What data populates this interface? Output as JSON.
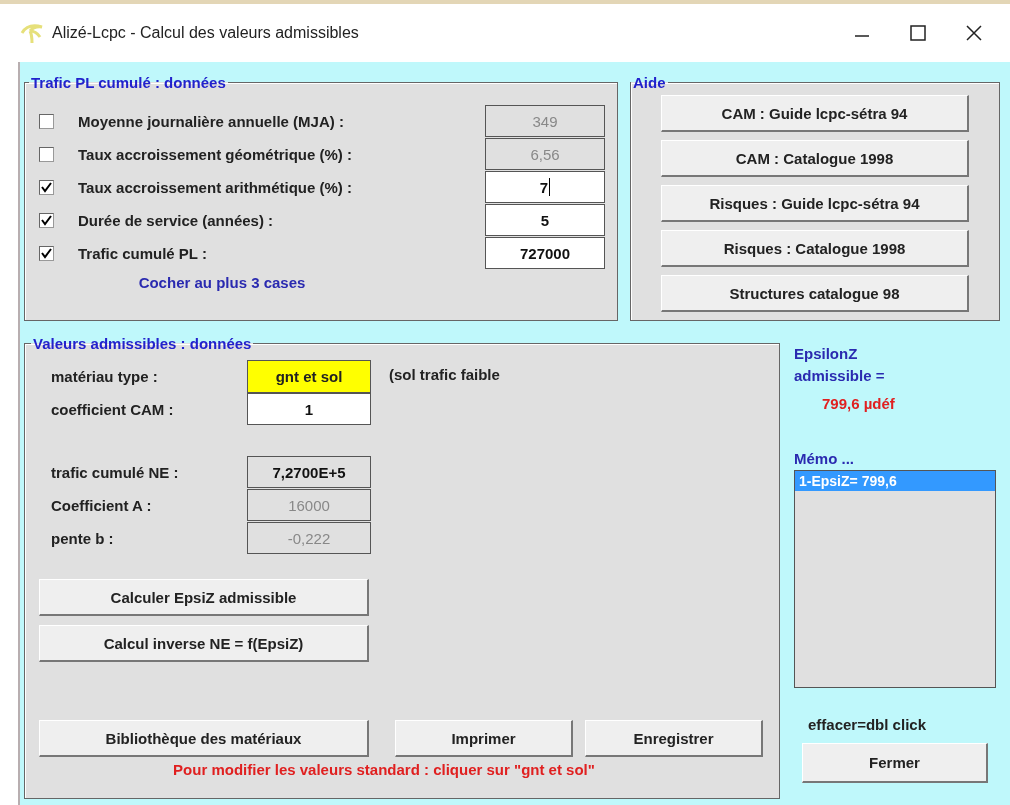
{
  "window": {
    "title": "Alizé-Lcpc - Calcul des valeurs admissibles"
  },
  "trafic": {
    "title": "Trafic PL cumulé : données",
    "rows": [
      {
        "label": "Moyenne journalière annuelle (MJA) :",
        "checked": false,
        "value": "349",
        "disabled": true,
        "focused": false
      },
      {
        "label": "Taux accroissement géométrique (%) :",
        "checked": false,
        "value": "6,56",
        "disabled": true,
        "focused": false
      },
      {
        "label": "Taux accroissement arithmétique (%) :",
        "checked": true,
        "value": "7",
        "disabled": false,
        "focused": true
      },
      {
        "label": "Durée de service  (années) :",
        "checked": true,
        "value": "5",
        "disabled": false,
        "focused": false
      },
      {
        "label": "Trafic cumulé PL :",
        "checked": true,
        "value": "727000",
        "disabled": false,
        "focused": false
      }
    ],
    "hint": "Cocher au plus 3 cases"
  },
  "aide": {
    "title": "Aide",
    "buttons": [
      "CAM : Guide lcpc-sétra 94",
      "CAM : Catalogue 1998",
      "Risques : Guide lcpc-sétra 94",
      "Risques : Catalogue 1998",
      "Structures catalogue 98"
    ]
  },
  "valeurs": {
    "title": "Valeurs admissibles : données",
    "material": {
      "label": "matériau type :",
      "value": "gnt et sol",
      "note": "(sol trafic faible"
    },
    "cam": {
      "label": "coefficient CAM :",
      "value": "1",
      "disabled": false
    },
    "params": [
      {
        "label": "trafic cumulé NE :",
        "value": "7,2700E+5",
        "disabled": false
      },
      {
        "label": "Coefficient A :",
        "value": "16000",
        "disabled": true
      },
      {
        "label": "pente b :",
        "value": "-0,222",
        "disabled": true
      }
    ],
    "actions": [
      "Calculer EpsiZ admissible",
      "Calcul inverse NE = f(EpsiZ)"
    ],
    "bottom_buttons": [
      "Bibliothèque des matériaux",
      "Imprimer",
      "Enregistrer"
    ],
    "footer": "Pour modifier les valeurs standard : cliquer sur \"gnt et sol\""
  },
  "result": {
    "label_line1": "EpsilonZ",
    "label_line2": "admissible =",
    "value": "799,6 µdéf"
  },
  "memo": {
    "title": "Mémo ...",
    "items": [
      {
        "text": "1-EpsiZ= 799,6",
        "selected": true
      }
    ]
  },
  "erase_hint": "effacer=dbl click",
  "close_button": "Fermer"
}
